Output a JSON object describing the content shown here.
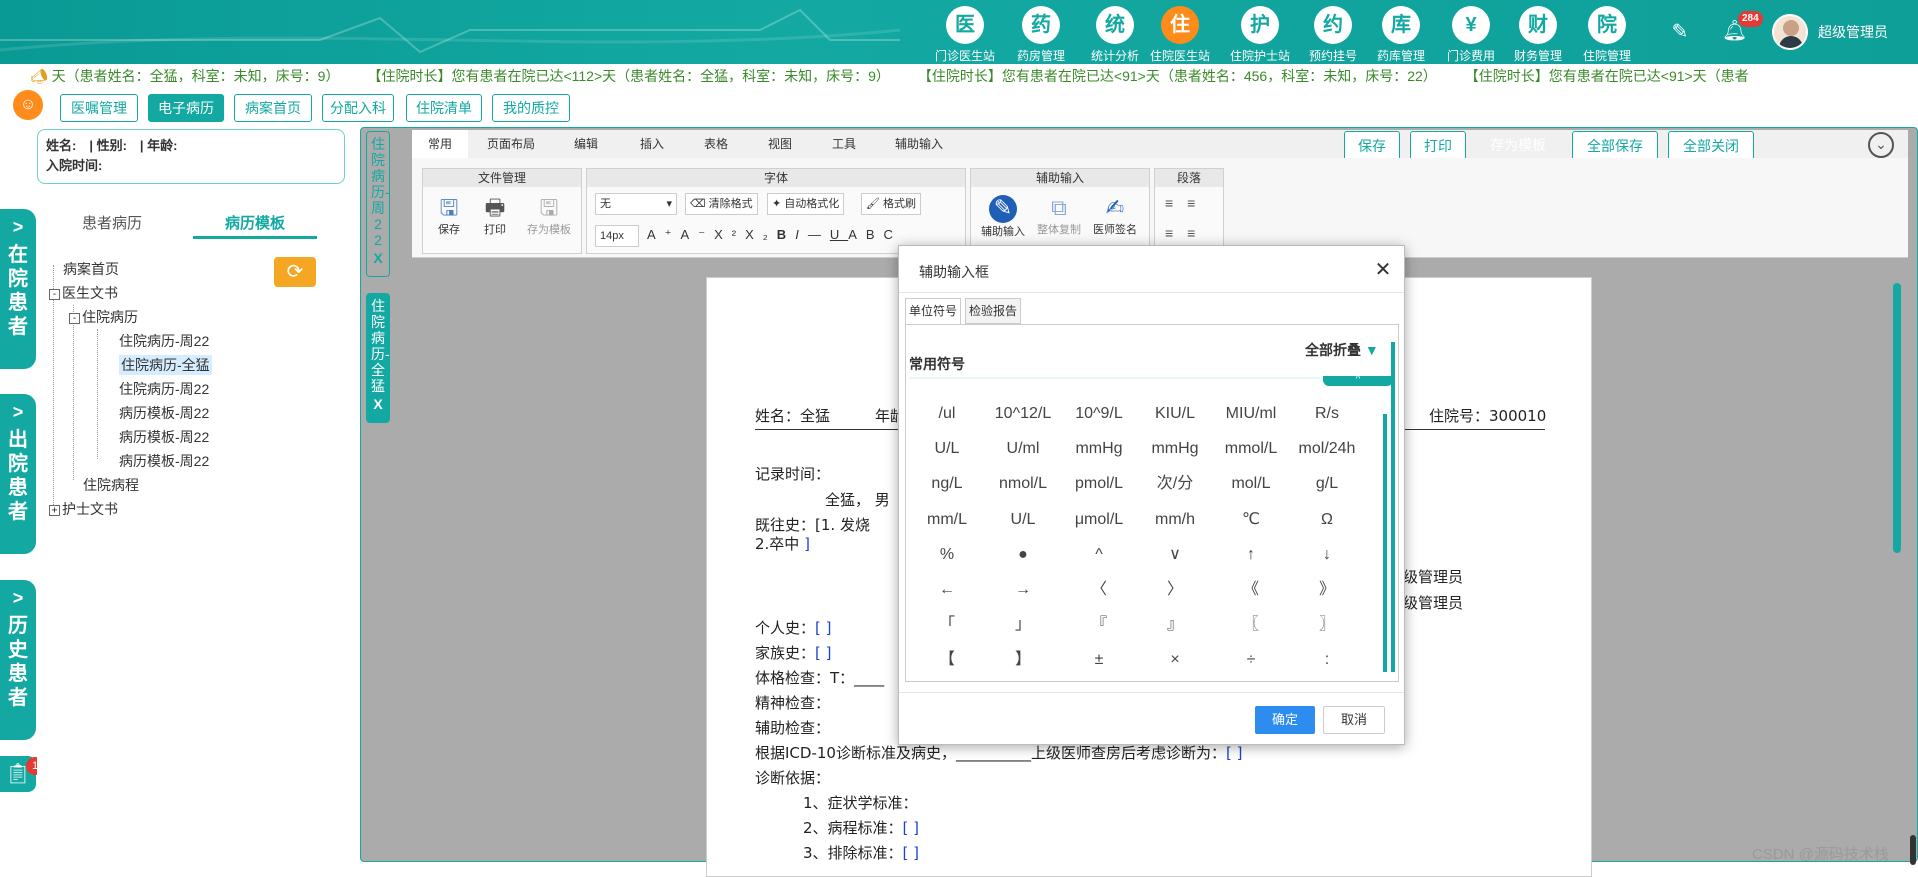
{
  "nav": {
    "items": [
      {
        "label": "门诊医生站",
        "glyph": "医"
      },
      {
        "label": "药房管理",
        "glyph": "药"
      },
      {
        "label": "统计分析",
        "glyph": "统"
      },
      {
        "label": "住院医生站",
        "glyph": "住"
      },
      {
        "label": "住院护士站",
        "glyph": "护"
      },
      {
        "label": "预约挂号",
        "glyph": "约"
      },
      {
        "label": "药库管理",
        "glyph": "库"
      },
      {
        "label": "门诊费用",
        "glyph": "¥"
      },
      {
        "label": "财务管理",
        "glyph": "财"
      },
      {
        "label": "住院管理",
        "glyph": "院"
      }
    ],
    "notification_count": "284",
    "user_name": "超级管理员"
  },
  "ticker": {
    "text": "天（患者姓名：全猛，科室：未知，床号：9）　　　【住院时长】您有患者在院已达<112>天（患者姓名：全猛，科室：未知，床号：9）　　　【住院时长】您有患者在院已达<91>天（患者姓名：456，科室：未知，床号：22）　　　【住院时长】您有患者在院已达<91>天（患者"
  },
  "top_tabs": [
    "医嘱管理",
    "电子病历",
    "病案首页",
    "分配入科",
    "住院清单",
    "我的质控"
  ],
  "side_tabs": {
    "in": "在院患者",
    "out": "出院患者",
    "history": "历史患者",
    "task_badge": "1"
  },
  "patient_info": {
    "line1": "姓名:　| 性别:　| 年龄:",
    "line2": "入院时间:"
  },
  "left_panel": {
    "tabs": [
      "患者病历",
      "病历模板"
    ],
    "tree": [
      {
        "label": "病案首页",
        "level": 0,
        "box": ""
      },
      {
        "label": "医生文书",
        "level": 0,
        "box": "-"
      },
      {
        "label": "住院病历",
        "level": 1,
        "box": "-"
      },
      {
        "label": "住院病历-周22",
        "level": 2,
        "box": ""
      },
      {
        "label": "住院病历-全猛",
        "level": 2,
        "box": ""
      },
      {
        "label": "住院病历-周22",
        "level": 2,
        "box": ""
      },
      {
        "label": "病历模板-周22",
        "level": 2,
        "box": ""
      },
      {
        "label": "病历模板-周22",
        "level": 2,
        "box": ""
      },
      {
        "label": "病历模板-周22",
        "level": 2,
        "box": ""
      },
      {
        "label": "住院病程",
        "level": 1,
        "box": ""
      },
      {
        "label": "护士文书",
        "level": 0,
        "box": "+"
      }
    ]
  },
  "doc_tabs": [
    {
      "label": "住院病历-周22",
      "close": "X"
    },
    {
      "label": "住院病历-全猛",
      "close": "X"
    }
  ],
  "ribbon": {
    "tabs": [
      "常用",
      "页面布局",
      "编辑",
      "插入",
      "表格",
      "视图",
      "工具",
      "辅助输入"
    ],
    "groups": {
      "file": "文件管理",
      "font": "字体",
      "aux": "辅助输入",
      "para": "段落"
    },
    "file_buttons": [
      "保存",
      "打印",
      "存为模板"
    ],
    "font_name": "无",
    "font_size": "14px",
    "format_buttons": [
      "清除格式",
      "自动格式化",
      "格式刷"
    ],
    "aux_buttons": [
      "辅助输入",
      "整体复制",
      "医师签名"
    ]
  },
  "actions": [
    "保存",
    "打印",
    "存为模板",
    "全部保存",
    "全部关闭"
  ],
  "document": {
    "name_line": "姓名：全猛　　　年龄",
    "admission_no": "住院号：300010",
    "record_time": "记录时间：",
    "summary": "全猛，  男",
    "past_history_a": "既往史：[",
    "past_history_b": "1. 发烧",
    "past_history_c": "2.卒中  ",
    "past_history_end": "]",
    "signer_1": "级管理员",
    "signer_2": "级管理员",
    "personal": "个人史：",
    "family": "家族史：",
    "physical": "体格检查：T：____",
    "mental": "精神检查：",
    "auxiliary": "辅助检查：",
    "icd_a": "根据ICD-10诊断标准及病史，",
    "icd_b": "__________上级医师查房后考虑诊断为：",
    "basis": "诊断依据：",
    "c1": "1、症状学标准：",
    "c2": "2、病程标准：",
    "c3": "3、排除标准：",
    "bracket": "[ ]"
  },
  "modal": {
    "title": "辅助输入框",
    "tabs": [
      "单位符号",
      "检验报告"
    ],
    "section": "常用符号",
    "collapse": "全部折叠",
    "symbols": [
      "/ul",
      "10^12/L",
      "10^9/L",
      "KIU/L",
      "MIU/ml",
      "R/s",
      "U/L",
      "U/ml",
      "mmHg",
      "mmHg",
      "mmol/L",
      "mol/24h",
      "ng/L",
      "nmol/L",
      "pmol/L",
      "次/分",
      "mol/L",
      "g/L",
      "mm/L",
      "U/L",
      "μmol/L",
      "mm/h",
      "℃",
      "Ω",
      "%",
      "●",
      "^",
      "∨",
      "↑",
      "↓",
      "←",
      "→",
      "〈",
      "〉",
      "《",
      "》",
      "「",
      "」",
      "『",
      "』",
      "〖",
      "〗",
      "【",
      "】",
      "±",
      "×",
      "÷",
      ":"
    ],
    "confirm": "确定",
    "cancel": "取消"
  },
  "watermark": "CSDN @源码技术栈"
}
